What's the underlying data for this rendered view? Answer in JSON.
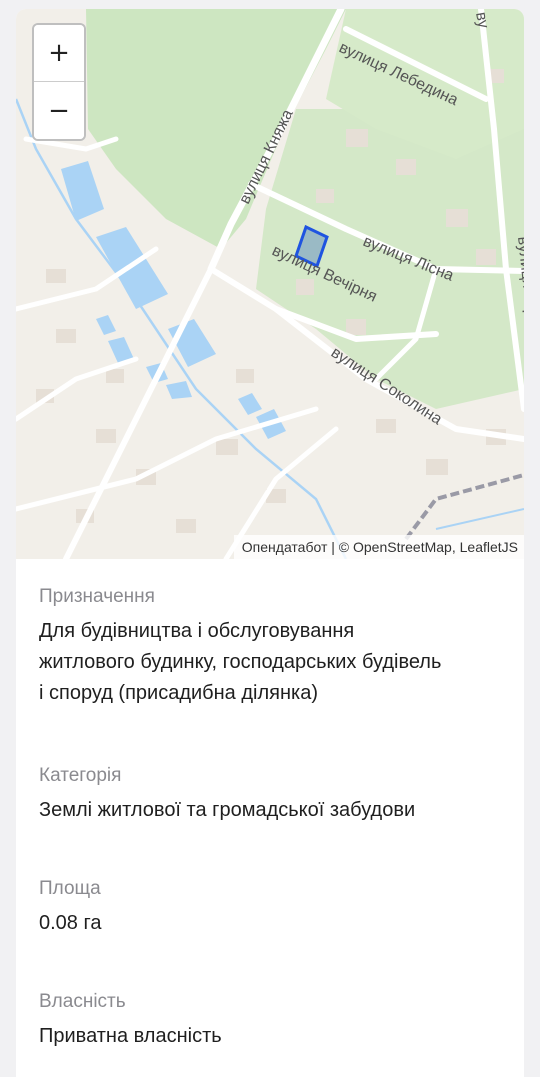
{
  "map": {
    "zoom_in_label": "+",
    "zoom_out_label": "−",
    "attribution": {
      "provider": "Опендатабот",
      "separator": " | © ",
      "osm": "OpenStreetMap",
      "comma": ", ",
      "leaflet": "LeafletJS"
    },
    "streets": {
      "lebedyna": "вулиця Лебедина",
      "kniazha": "вулиця Княжа",
      "lisna": "вулиця Лісна",
      "vechirnia": "вулиця Вечірня",
      "sokolyna": "вулиця Соколина",
      "top_right_partial": "ву",
      "right_partial": "вулиця Гербова"
    },
    "colors": {
      "land": "#f2efe9",
      "park": "#cde6c1",
      "water": "#aad3f5",
      "road": "#ffffff",
      "parcel_outline": "#1f54e0",
      "parcel_fill": "#8fb1c4",
      "rail": "#9a9aa6"
    }
  },
  "details": [
    {
      "label": "Призначення",
      "value_lines": [
        "Для будівництва і обслуговування",
        "житлового будинку, господарських будівель",
        "і споруд (присадибна ділянка)"
      ]
    },
    {
      "label": "Категорія",
      "value_lines": [
        "Землі житлової та громадської забудови"
      ]
    },
    {
      "label": "Площа",
      "value_lines": [
        "0.08 га"
      ]
    },
    {
      "label": "Власність",
      "value_lines": [
        "Приватна власність"
      ]
    }
  ]
}
